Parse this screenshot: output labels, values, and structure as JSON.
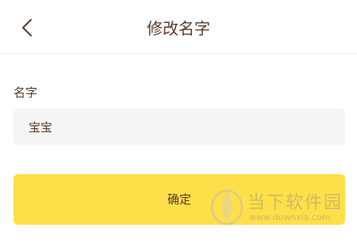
{
  "header": {
    "title": "修改名字",
    "back_icon": "chevron-left-icon"
  },
  "form": {
    "name_label": "名字",
    "name_value": "宝宝"
  },
  "actions": {
    "confirm_label": "确定"
  },
  "watermark": {
    "title": "当下软件园",
    "url": "www.downxia.com"
  },
  "colors": {
    "accent": "#ffe04a",
    "text": "#5a3a2a",
    "input_bg": "#f5f5f5",
    "divider": "#eeeeee"
  }
}
